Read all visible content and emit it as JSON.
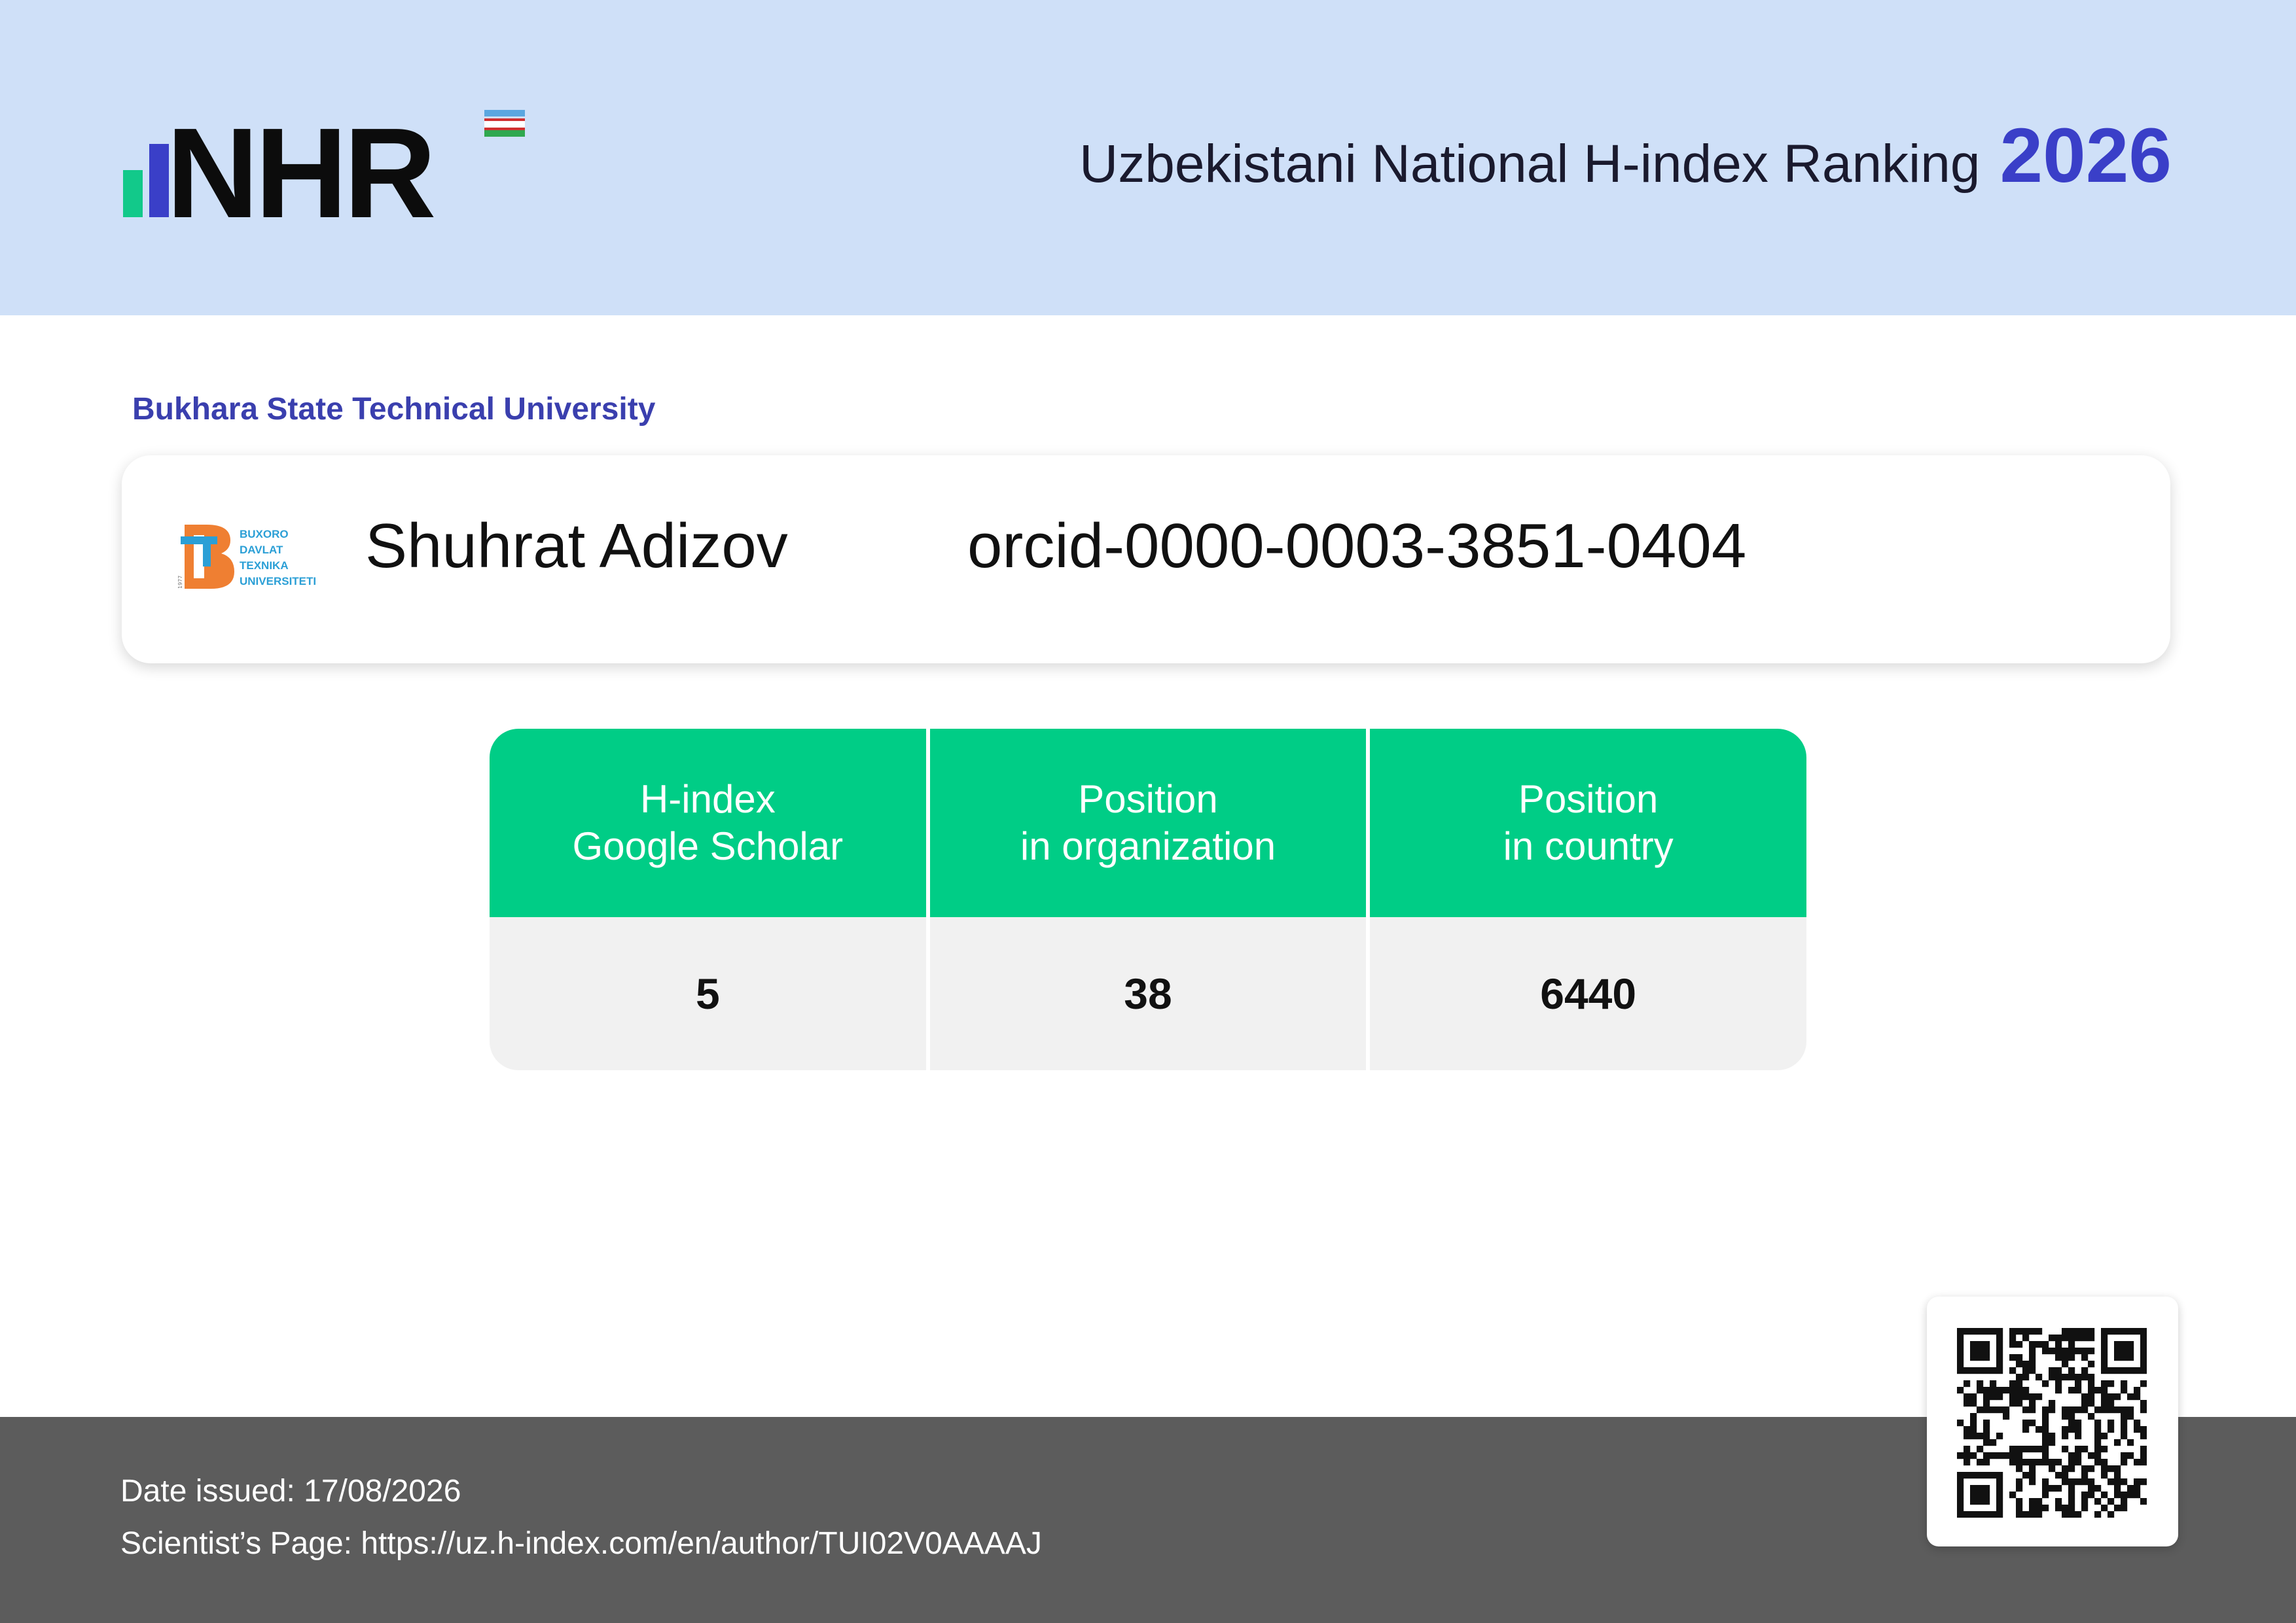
{
  "header": {
    "logo_text": "NHR",
    "title": "Uzbekistani National H-index Ranking",
    "year": "2026",
    "colors": {
      "background": "#cfe0f8",
      "accent": "#3a3fc8",
      "bar_green": "#12c98a",
      "bar_blue": "#3a3fc8"
    }
  },
  "organization": {
    "name": "Bukhara State Technical University",
    "logo_lines": [
      "BUXORO",
      "DAVLAT",
      "TEXNIKA",
      "UNIVERSITETI"
    ],
    "logo_year": "1977"
  },
  "person": {
    "name": "Shuhrat Adizov",
    "orcid": "orcid-0000-0003-3851-0404"
  },
  "stats": [
    {
      "label_line1": "H-index",
      "label_line2": "Google Scholar",
      "value": "5"
    },
    {
      "label_line1": "Position",
      "label_line2": "in organization",
      "value": "38"
    },
    {
      "label_line1": "Position",
      "label_line2": "in country",
      "value": "6440"
    }
  ],
  "footer": {
    "date_label": "Date issued:",
    "date_value": "17/08/2026",
    "page_label": "Scientist’s Page:",
    "page_url": "https://uz.h-index.com/en/author/TUI02V0AAAAJ"
  },
  "qr": {
    "icon": "qr-code-icon"
  }
}
